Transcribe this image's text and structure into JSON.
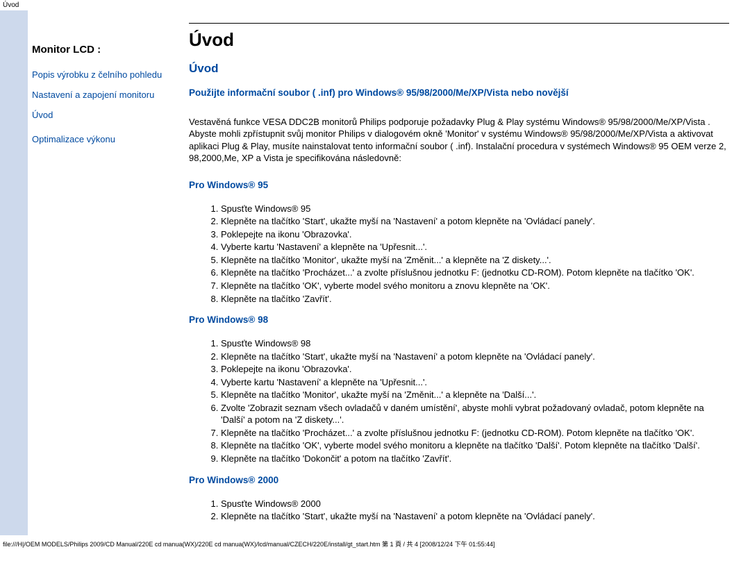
{
  "topbar": "Úvod",
  "sidebar": {
    "title": "Monitor LCD :",
    "links": [
      "Popis výrobku z čelního pohledu",
      "Nastavení a zapojení monitoru",
      "Úvod",
      "Optimalizace výkonu"
    ]
  },
  "content": {
    "page_title": "Úvod",
    "sub_title": "Úvod",
    "inf_line": "Použijte informační soubor ( .inf) pro Windows® 95/98/2000/Me/XP/Vista nebo novější",
    "intro_para": "Vestavěná funkce VESA DDC2B monitorů Philips podporuje požadavky Plug & Play systému Windows® 95/98/2000/Me/XP/Vista . Abyste mohli zpřístupnit svůj monitor Philips v dialogovém okně 'Monitor' v systému Windows® 95/98/2000/Me/XP/Vista a aktivovat aplikaci Plug & Play, musíte nainstalovat tento informační soubor ( .inf). Instalační procedura v systémech Windows® 95 OEM verze 2, 98,2000,Me, XP a Vista  je specifikována následovně:",
    "sections": [
      {
        "heading": "Pro Windows® 95",
        "steps": [
          "Spusťte Windows® 95",
          "Klepněte na tlačítko 'Start', ukažte myší na 'Nastavení' a potom klepněte na 'Ovládací panely'.",
          "Poklepejte na ikonu 'Obrazovka'.",
          "Vyberte kartu 'Nastavení' a klepněte na 'Upřesnit...'.",
          "Klepněte na tlačítko 'Monitor', ukažte myší na 'Změnit...' a klepněte na 'Z diskety...'.",
          "Klepněte na tlačítko 'Procházet...' a zvolte příslušnou jednotku F: (jednotku CD-ROM). Potom klepněte na tlačítko 'OK'.",
          "Klepněte na tlačítko 'OK', vyberte model svého monitoru a znovu klepněte na 'OK'.",
          "Klepněte na tlačítko 'Zavřít'."
        ]
      },
      {
        "heading": "Pro Windows® 98",
        "steps": [
          "Spusťte Windows® 98",
          "Klepněte na tlačítko 'Start', ukažte myší na 'Nastavení' a potom klepněte na 'Ovládací panely'.",
          "Poklepejte na ikonu 'Obrazovka'.",
          "Vyberte kartu 'Nastavení' a klepněte na 'Upřesnit...'.",
          "Klepněte na tlačítko 'Monitor', ukažte myší na 'Změnit...' a klepněte na 'Další...'.",
          "Zvolte 'Zobrazit seznam všech ovladačů v daném umístění', abyste mohli vybrat požadovaný ovladač, potom klepněte na 'Další' a potom na 'Z diskety...'.",
          "Klepněte na tlačítko 'Procházet...' a zvolte příslušnou jednotku F: (jednotku CD-ROM). Potom klepněte na tlačítko 'OK'.",
          "Klepněte na tlačítko 'OK', vyberte model svého monitoru a klepněte na tlačítko 'Další'. Potom klepněte na tlačítko 'Další'.",
          "Klepněte na tlačítko 'Dokončit' a potom na tlačítko 'Zavřít'."
        ]
      },
      {
        "heading": "Pro Windows® 2000",
        "steps": [
          "Spusťte Windows® 2000",
          "Klepněte na tlačítko 'Start', ukažte myší na 'Nastavení' a potom klepněte na 'Ovládací panely'."
        ]
      }
    ]
  },
  "footer": "file:///H|/OEM MODELS/Philips 2009/CD Manual/220E cd manua(WX)/220E cd manua(WX)/lcd/manual/CZECH/220E/install/gt_start.htm 第 1 頁 / 共 4  [2008/12/24 下午 01:55:44]"
}
